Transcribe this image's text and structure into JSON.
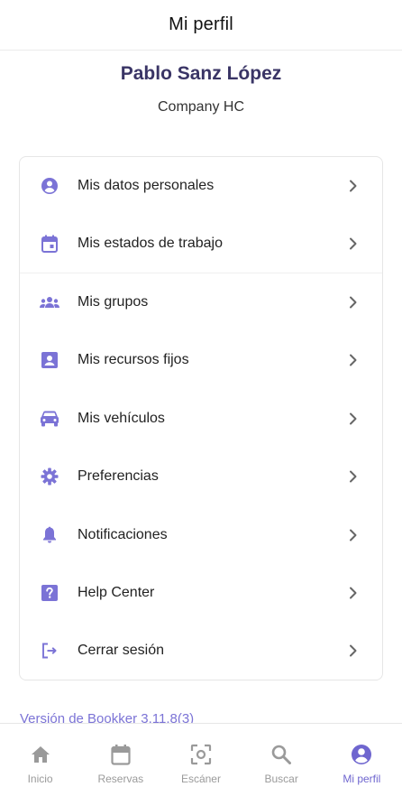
{
  "header": {
    "title": "Mi perfil"
  },
  "profile": {
    "name": "Pablo Sanz López",
    "company": "Company HC"
  },
  "menu": {
    "items": [
      {
        "label": "Mis datos personales",
        "icon": "account-circle-icon"
      },
      {
        "label": "Mis estados de trabajo",
        "icon": "calendar-icon"
      },
      {
        "label": "Mis grupos",
        "icon": "groups-icon"
      },
      {
        "label": "Mis recursos fijos",
        "icon": "badge-icon"
      },
      {
        "label": "Mis vehículos",
        "icon": "car-icon"
      },
      {
        "label": "Preferencias",
        "icon": "gear-icon"
      },
      {
        "label": "Notificaciones",
        "icon": "bell-icon"
      },
      {
        "label": "Help Center",
        "icon": "help-icon"
      },
      {
        "label": "Cerrar sesión",
        "icon": "logout-icon"
      }
    ]
  },
  "version": {
    "text": "Versión de Bookker 3.11.8(3)"
  },
  "tabbar": {
    "tabs": [
      {
        "label": "Inicio",
        "icon": "home-icon"
      },
      {
        "label": "Reservas",
        "icon": "calendar-icon"
      },
      {
        "label": "Escáner",
        "icon": "scanner-icon"
      },
      {
        "label": "Buscar",
        "icon": "search-icon"
      },
      {
        "label": "Mi perfil",
        "icon": "account-circle-icon",
        "active": true
      }
    ]
  },
  "colors": {
    "accent": "#7b73d6",
    "accent_dark": "#3a3566",
    "inactive": "#9a9a9a"
  }
}
